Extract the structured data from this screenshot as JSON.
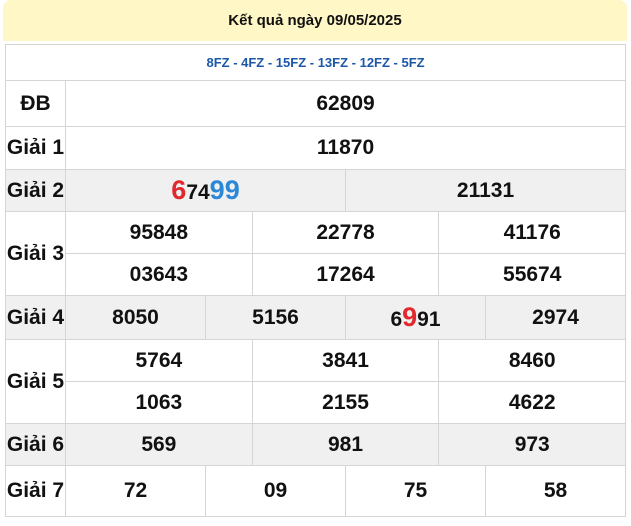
{
  "header": {
    "title": "Kết quả ngày 09/05/2025"
  },
  "codes": "8FZ - 4FZ - 15FZ - 13FZ - 12FZ - 5FZ",
  "labels": {
    "db": "ĐB",
    "g1": "Giải 1",
    "g2": "Giải 2",
    "g3": "Giải 3",
    "g4": "Giải 4",
    "g5": "Giải 5",
    "g6": "Giải 6",
    "g7": "Giải 7"
  },
  "db": "62809",
  "g1": "11870",
  "g2": [
    {
      "parts": [
        "6",
        "74",
        "99"
      ]
    },
    {
      "value": "21131"
    }
  ],
  "g3": [
    "95848",
    "22778",
    "41176",
    "03643",
    "17264",
    "55674"
  ],
  "g4": [
    {
      "value": "8050"
    },
    {
      "value": "5156"
    },
    {
      "parts": [
        "6",
        "9",
        "91"
      ]
    },
    {
      "value": "2974"
    }
  ],
  "g5": [
    "5764",
    "3841",
    "8460",
    "1063",
    "2155",
    "4622"
  ],
  "g6": [
    "569",
    "981",
    "973"
  ],
  "g7": [
    "72",
    "09",
    "75",
    "58"
  ],
  "colors": {
    "highlight_red": "#e0282e",
    "highlight_blue": "#2b87d8",
    "code_blue": "#1c57a8",
    "title_bg": "#fff7c6",
    "shade_bg": "#f0f0f0"
  }
}
